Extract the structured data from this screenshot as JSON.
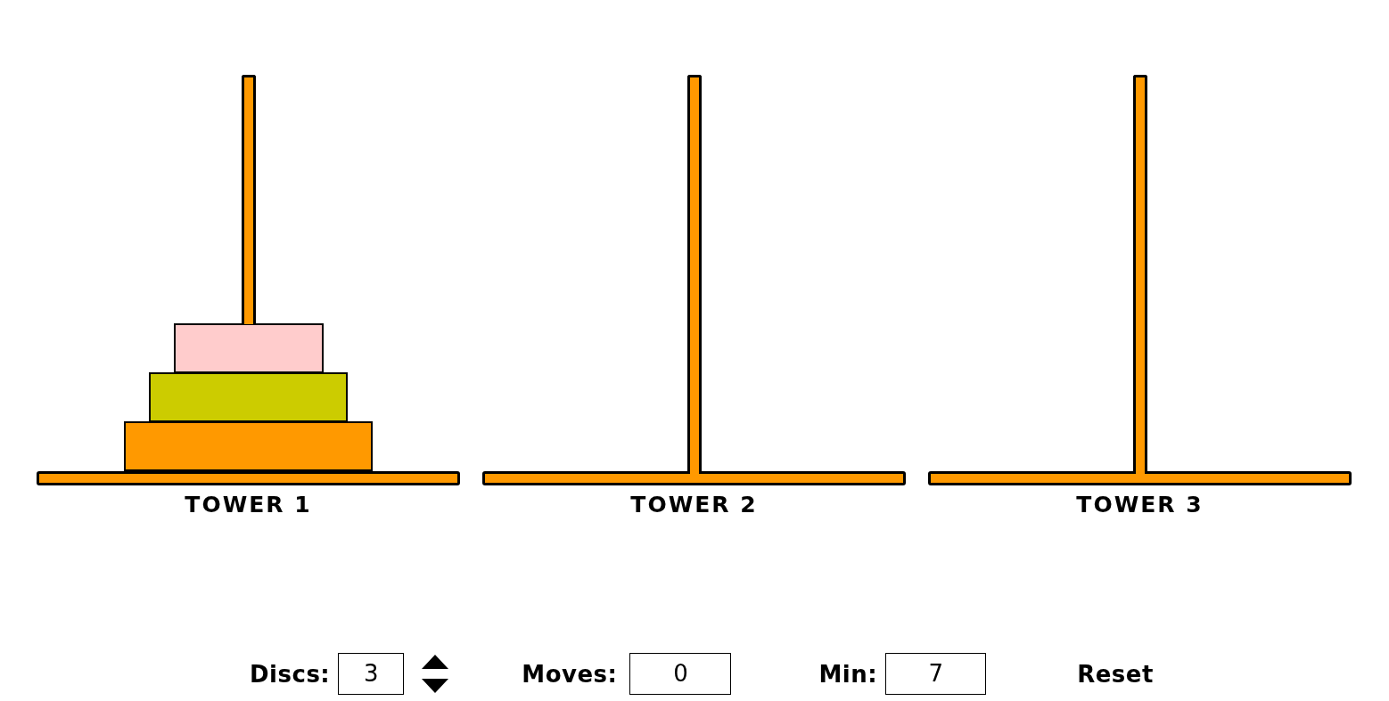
{
  "towers": [
    {
      "label": "TOWER 1",
      "discs": [
        {
          "color": "#ffcccc"
        },
        {
          "color": "#cccc00"
        },
        {
          "color": "#ff9900"
        }
      ]
    },
    {
      "label": "TOWER 2"
    },
    {
      "label": "TOWER 3"
    }
  ],
  "controls": {
    "discs": {
      "label": "Discs:",
      "value": "3"
    },
    "moves": {
      "label": "Moves:",
      "value": "0"
    },
    "min": {
      "label": "Min:",
      "value": "7"
    },
    "reset": "Reset"
  }
}
